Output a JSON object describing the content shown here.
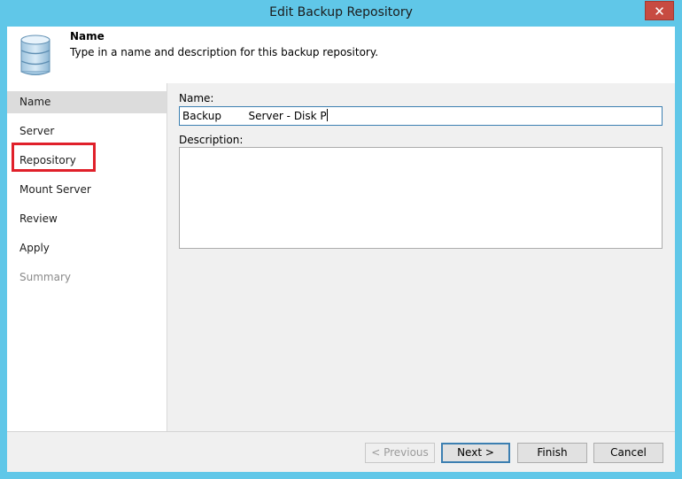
{
  "window": {
    "title": "Edit Backup Repository",
    "close_glyph": "✕"
  },
  "header": {
    "icon": "database-icon",
    "title": "Name",
    "description": "Type in a name and description for this backup repository."
  },
  "nav": {
    "items": [
      {
        "label": "Name",
        "state": "active"
      },
      {
        "label": "Server",
        "state": "normal"
      },
      {
        "label": "Repository",
        "state": "normal"
      },
      {
        "label": "Mount Server",
        "state": "normal"
      },
      {
        "label": "Review",
        "state": "normal"
      },
      {
        "label": "Apply",
        "state": "normal"
      },
      {
        "label": "Summary",
        "state": "disabled"
      }
    ]
  },
  "form": {
    "name_label": "Name:",
    "name_value": "Backup        Server - Disk P",
    "description_label": "Description:",
    "description_value": ""
  },
  "buttons": {
    "previous": "< Previous",
    "next": "Next >",
    "finish": "Finish",
    "cancel": "Cancel"
  },
  "colors": {
    "titlebar": "#60c7e8",
    "close": "#c74b41",
    "highlight": "#e0202a"
  }
}
